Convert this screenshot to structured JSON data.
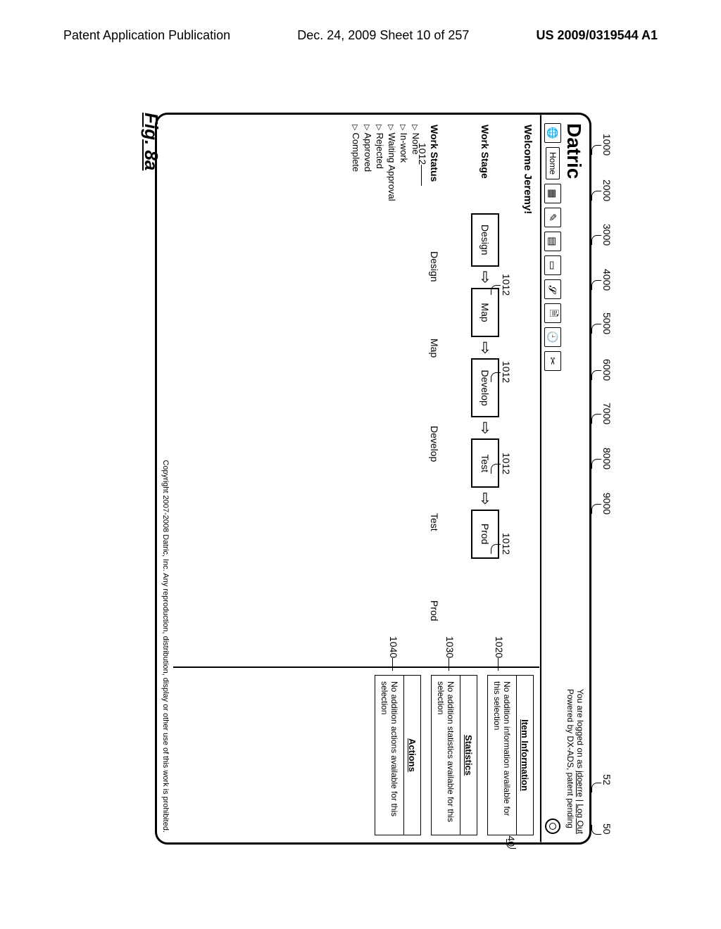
{
  "page_header": {
    "left": "Patent Application Publication",
    "center": "Dec. 24, 2009  Sheet 10 of 257",
    "right": "US 2009/0319544 A1"
  },
  "figure_label": "Fig. 8a",
  "top_refs": [
    "1000",
    "2000",
    "3000",
    "4000",
    "5000",
    "6000",
    "7000",
    "8000",
    "9000"
  ],
  "right_refs": {
    "r50": "50",
    "r52": "52",
    "r40": "40"
  },
  "brand": "Datric",
  "login": {
    "prefix": "You are logged on as ",
    "user": "jdoerre",
    "sep": " | ",
    "logout": "Log Out",
    "line2": "Powered by DX-ADS, patent pending"
  },
  "toolbar": {
    "home_label": "Home",
    "icons": [
      "globe-icon",
      "grid-icon",
      "pencil-icon",
      "stack-icon",
      "card-icon",
      "link-icon",
      "note-icon",
      "clock-icon",
      "cut-icon"
    ]
  },
  "welcome": "Welcome Jeremy!",
  "work_stage": {
    "label": "Work Stage",
    "ref": "1012",
    "stages": [
      "Design",
      "Map",
      "Develop",
      "Test",
      "Prod"
    ]
  },
  "work_status": {
    "label": "Work Status",
    "columns": [
      "Design",
      "Map",
      "Develop",
      "Test",
      "Prod"
    ],
    "items": [
      "None",
      "In-work",
      "Waiting Approval",
      "Rejected",
      "Approved",
      "Complete"
    ]
  },
  "side": {
    "item_info": {
      "ref": "1020",
      "title": "Item Information",
      "body": "No addition information available for this selection"
    },
    "stats": {
      "ref": "1030",
      "title": "Statistics",
      "body": "No addition statistics available for this selection"
    },
    "actions": {
      "ref": "1040",
      "title": "Actions",
      "body": "No addition actions available for this selection"
    }
  },
  "footer": "Copyright 2007-2008 Datric, Inc.  Any reproduction, distribution, display or other use of this work is prohibited."
}
